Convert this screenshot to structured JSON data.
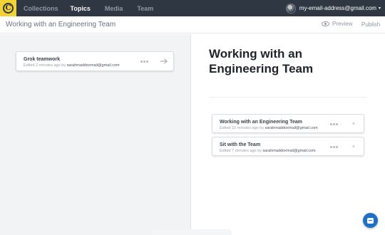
{
  "nav": {
    "logo_letter": "C",
    "items": [
      {
        "label": "Collections",
        "active": false
      },
      {
        "label": "Topics",
        "active": true
      },
      {
        "label": "Media",
        "active": false
      },
      {
        "label": "Team",
        "active": false
      }
    ],
    "user_email": "my-email-address@gmail.com",
    "caret": "▾"
  },
  "subheader": {
    "title": "Working with an Engineering Team",
    "preview_label": "Preview",
    "publish_label": "Publish"
  },
  "left": {
    "cards": [
      {
        "title": "Grok teamwork",
        "meta_prefix": "Edited 2 minutes ago by",
        "meta_author": "sarahmaddoxmail@gmail.com"
      }
    ]
  },
  "right": {
    "collection_title": "Working with an Engineering Team",
    "cards": [
      {
        "title": "Working with an Engineering Team",
        "meta_prefix": "Edited 10 minutes ago by",
        "meta_author": "sarahmaddoxmail@gmail.com",
        "remove": "×"
      },
      {
        "title": "Sit with the Team",
        "meta_prefix": "Edited 7 minutes ago by",
        "meta_author": "sarahmaddoxmail@gmail.com",
        "remove": "×"
      }
    ]
  },
  "colors": {
    "nav_bg": "#2e3742",
    "logo_bg": "#f3d233",
    "chat_bg": "#1f6fc5",
    "left_panel_bg": "#f2f3f5"
  },
  "icons": [
    "logo-icon",
    "avatar",
    "eye-icon",
    "more-dots-icon",
    "arrow-right-icon",
    "close-icon",
    "chat-icon"
  ]
}
